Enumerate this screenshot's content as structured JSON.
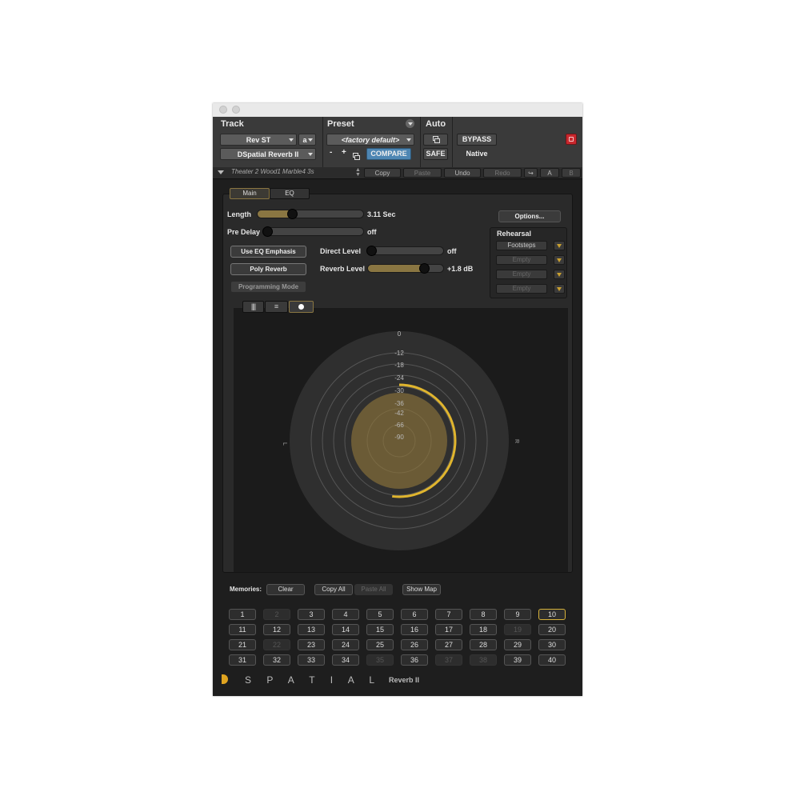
{
  "header": {
    "track_label": "Track",
    "preset_label": "Preset",
    "auto_label": "Auto",
    "track_name": "Rev ST",
    "track_channel": "a",
    "plugin_name": "DSpatial Reverb II",
    "preset_name": "<factory default>",
    "minus": "-",
    "plus": "+",
    "compare": "COMPARE",
    "safe": "SAFE",
    "bypass": "BYPASS",
    "native": "Native"
  },
  "toolbar": {
    "preset_path": "Theater 2 Wood1 Marble4 3s",
    "copy": "Copy",
    "paste": "Paste",
    "undo": "Undo",
    "redo": "Redo",
    "a": "A",
    "b": "B"
  },
  "tabs": {
    "main": "Main",
    "eq": "EQ"
  },
  "params": {
    "length_label": "Length",
    "length_value": "3.11 Sec",
    "length_fraction": 0.33,
    "predelay_label": "Pre Delay",
    "predelay_value": "off",
    "predelay_fraction": 0.0,
    "direct_label": "Direct Level",
    "direct_value": "off",
    "direct_fraction": 0.0,
    "reverb_label": "Reverb Level",
    "reverb_value": "+1.8 dB",
    "reverb_fraction": 0.74
  },
  "buttons": {
    "eq_emphasis": "Use EQ Emphasis",
    "poly_reverb": "Poly Reverb",
    "programming_mode": "Programming Mode",
    "options": "Options..."
  },
  "rehearsal": {
    "title": "Rehearsal",
    "slots": [
      "Footsteps",
      "Empty",
      "Empty",
      "Empty"
    ]
  },
  "radar": {
    "ticks": [
      "0",
      "-12",
      "-18",
      "-24",
      "-30",
      "-36",
      "-42",
      "-66",
      "-90"
    ],
    "left": "L",
    "right": "R",
    "level_fraction": 0.52
  },
  "memories": {
    "label": "Memories:",
    "clear": "Clear",
    "copy_all": "Copy All",
    "paste_all": "Paste All",
    "show_map": "Show Map",
    "numbers": [
      "1",
      "2",
      "3",
      "4",
      "5",
      "6",
      "7",
      "8",
      "9",
      "10",
      "11",
      "12",
      "13",
      "14",
      "15",
      "16",
      "17",
      "18",
      "19",
      "20",
      "21",
      "22",
      "23",
      "24",
      "25",
      "26",
      "27",
      "28",
      "29",
      "30",
      "31",
      "32",
      "33",
      "34",
      "35",
      "36",
      "37",
      "38",
      "39",
      "40"
    ],
    "dim": [
      "2",
      "19",
      "22",
      "35",
      "37",
      "38"
    ],
    "selected": "10"
  },
  "brand": {
    "logo_text": "S P A T I A L",
    "product": "Reverb II"
  },
  "colors": {
    "accent_gold": "#d6b23a",
    "compare_blue": "#4e86b3",
    "close_red": "#c8282e"
  }
}
